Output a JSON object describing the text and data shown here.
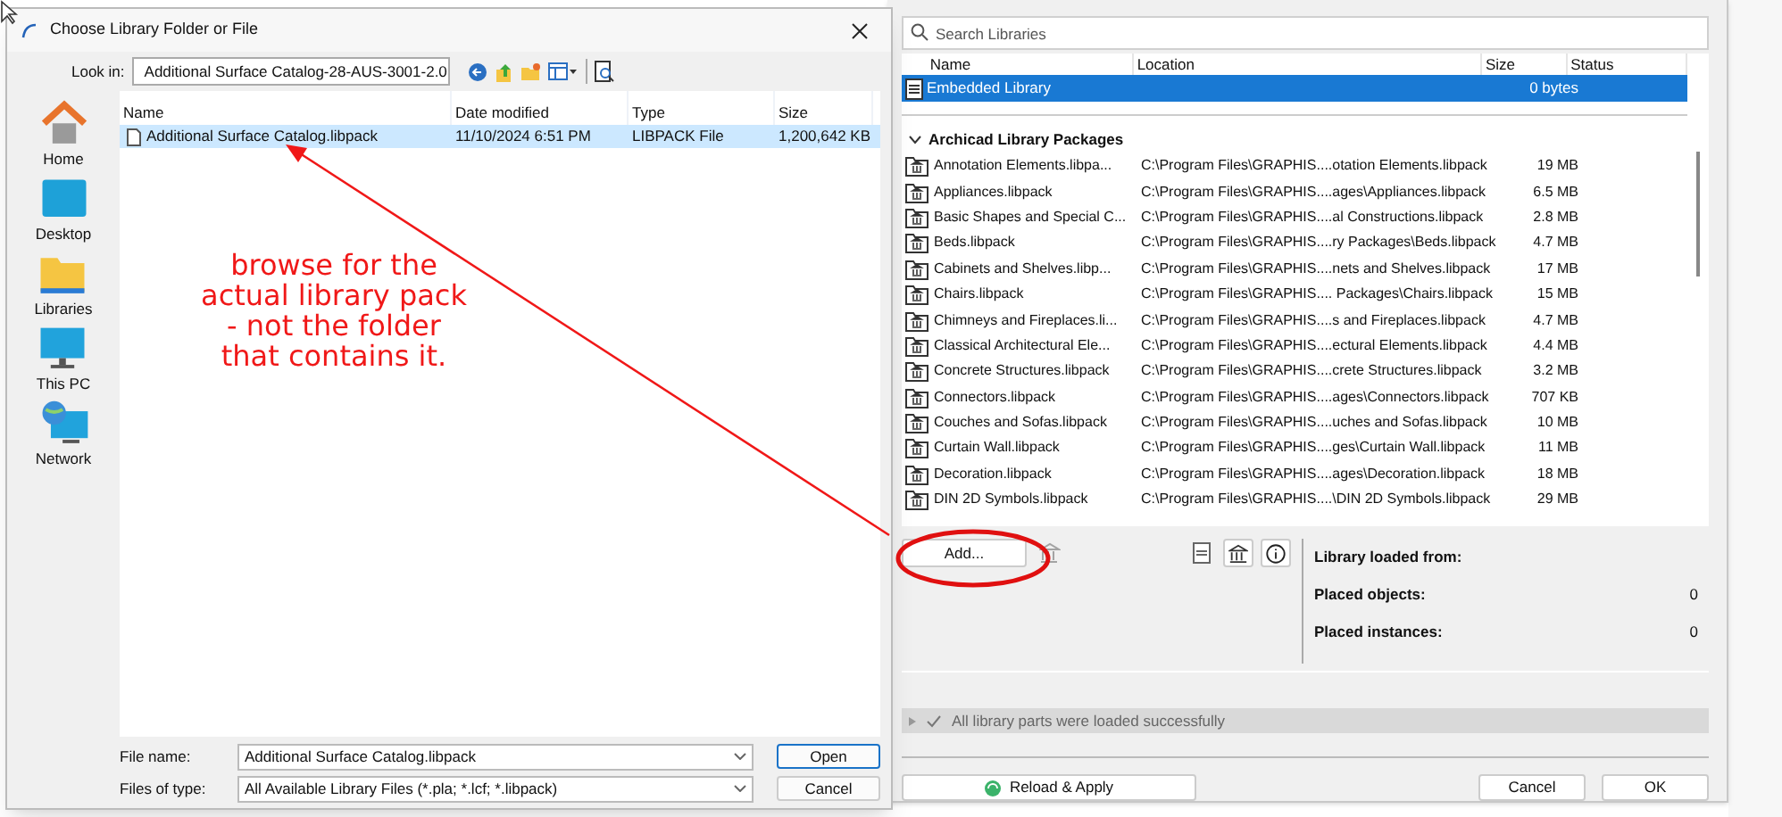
{
  "file_dialog": {
    "title": "Choose Library Folder or File",
    "look_in": {
      "label": "Look in:",
      "value": "Additional Surface Catalog-28-AUS-3001-2.0"
    },
    "places": [
      {
        "label": "Home",
        "kind": "home"
      },
      {
        "label": "Desktop",
        "kind": "desktop"
      },
      {
        "label": "Libraries",
        "kind": "libraries"
      },
      {
        "label": "This PC",
        "kind": "pc"
      },
      {
        "label": "Network",
        "kind": "network"
      }
    ],
    "columns": [
      "Name",
      "Date modified",
      "Type",
      "Size"
    ],
    "files": [
      {
        "name": "Additional Surface Catalog.libpack",
        "date": "11/10/2024 6:51 PM",
        "type": "LIBPACK File",
        "size": "1,200,642 KB",
        "selected": true
      }
    ],
    "file_name": {
      "label": "File name:",
      "value": "Additional Surface Catalog.libpack"
    },
    "file_type": {
      "label": "Files of type:",
      "value": "All Available Library Files (*.pla; *.lcf; *.libpack)"
    },
    "buttons": [
      "Open",
      "Cancel"
    ]
  },
  "annotation": {
    "lines": [
      "browse for the",
      "actual library pack",
      "- not the folder",
      "that contains it."
    ]
  },
  "library_manager": {
    "search": {
      "placeholder": "Search Libraries"
    },
    "columns": [
      "Name",
      "Location",
      "Size",
      "Status"
    ],
    "embedded": [
      {
        "name": "Embedded Library",
        "size": "0 bytes",
        "selected": true
      }
    ],
    "group": {
      "label": "Archicad Library Packages",
      "expanded": true
    },
    "packages": [
      {
        "name": "Annotation Elements.libpa...",
        "location": "C:\\Program Files\\GRAPHIS....otation Elements.libpack",
        "size": "19 MB",
        "selected": false
      },
      {
        "name": "Appliances.libpack",
        "location": "C:\\Program Files\\GRAPHIS....ages\\Appliances.libpack",
        "size": "6.5 MB",
        "selected": false
      },
      {
        "name": "Basic Shapes and Special C...",
        "location": "C:\\Program Files\\GRAPHIS....al Constructions.libpack",
        "size": "2.8 MB",
        "selected": false
      },
      {
        "name": "Beds.libpack",
        "location": "C:\\Program Files\\GRAPHIS....ry Packages\\Beds.libpack",
        "size": "4.7 MB",
        "selected": false
      },
      {
        "name": "Cabinets and Shelves.libp...",
        "location": "C:\\Program Files\\GRAPHIS....nets and Shelves.libpack",
        "size": "17 MB",
        "selected": false
      },
      {
        "name": "Chairs.libpack",
        "location": "C:\\Program Files\\GRAPHIS.... Packages\\Chairs.libpack",
        "size": "15 MB",
        "selected": false
      },
      {
        "name": "Chimneys and Fireplaces.li...",
        "location": "C:\\Program Files\\GRAPHIS....s and Fireplaces.libpack",
        "size": "4.7 MB",
        "selected": false
      },
      {
        "name": "Classical Architectural Ele...",
        "location": "C:\\Program Files\\GRAPHIS....ectural Elements.libpack",
        "size": "4.4 MB",
        "selected": false
      },
      {
        "name": "Concrete Structures.libpack",
        "location": "C:\\Program Files\\GRAPHIS....crete Structures.libpack",
        "size": "3.2 MB",
        "selected": false
      },
      {
        "name": "Connectors.libpack",
        "location": "C:\\Program Files\\GRAPHIS....ages\\Connectors.libpack",
        "size": "707 KB",
        "selected": false
      },
      {
        "name": "Couches and Sofas.libpack",
        "location": "C:\\Program Files\\GRAPHIS....uches and Sofas.libpack",
        "size": "10 MB",
        "selected": false
      },
      {
        "name": "Curtain Wall.libpack",
        "location": "C:\\Program Files\\GRAPHIS....ges\\Curtain Wall.libpack",
        "size": "11 MB",
        "selected": false
      },
      {
        "name": "Decoration.libpack",
        "location": "C:\\Program Files\\GRAPHIS....ages\\Decoration.libpack",
        "size": "18 MB",
        "selected": false
      },
      {
        "name": "DIN 2D Symbols.libpack",
        "location": "C:\\Program Files\\GRAPHIS....\\DIN 2D Symbols.libpack",
        "size": "29 MB",
        "selected": false
      }
    ],
    "add_button": "Add...",
    "info": [
      {
        "label": "Library loaded from:"
      },
      {
        "label": "Placed objects:",
        "value": "0"
      },
      {
        "label": "Placed instances:",
        "value": "0"
      }
    ],
    "status": "All library parts were loaded successfully",
    "reload_button": "Reload & Apply",
    "buttons": [
      "Cancel",
      "OK"
    ]
  }
}
